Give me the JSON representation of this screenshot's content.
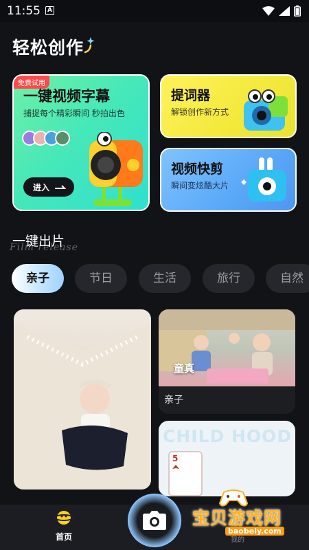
{
  "status": {
    "time": "11:55",
    "indicator": "A"
  },
  "header": {
    "title": "轻松创作"
  },
  "cards": {
    "main": {
      "badge": "免费试用",
      "title": "一键视频字幕",
      "subtitle": "捕捉每个精彩瞬间 秒拍出色",
      "button": "进入"
    },
    "prompter": {
      "title": "提词器",
      "subtitle": "解锁创作新方式"
    },
    "video_edit": {
      "title": "视频快剪",
      "subtitle": "瞬间变炫酷大片"
    }
  },
  "section": {
    "title": "一键出片",
    "script": "Film release"
  },
  "tabs": [
    {
      "label": "亲子",
      "active": true
    },
    {
      "label": "节日",
      "active": false
    },
    {
      "label": "生活",
      "active": false
    },
    {
      "label": "旅行",
      "active": false
    },
    {
      "label": "自然",
      "active": false
    }
  ],
  "photos": {
    "right_top": {
      "overlay": "童真",
      "label": "亲子"
    },
    "right_bottom": {
      "decor_text": "CHILD HOOD",
      "card_value": "5"
    }
  },
  "nav": {
    "home_label": "首页",
    "mine_label": "我的"
  },
  "watermark": {
    "text": "宝贝游戏网",
    "url": "baobeiy.com"
  },
  "colors": {
    "background": "#121317",
    "main_card": "#47e8b8",
    "prompter_card": "#f3e93c",
    "video_card": "#5aa8f8",
    "badge": "#ff4a4a"
  }
}
